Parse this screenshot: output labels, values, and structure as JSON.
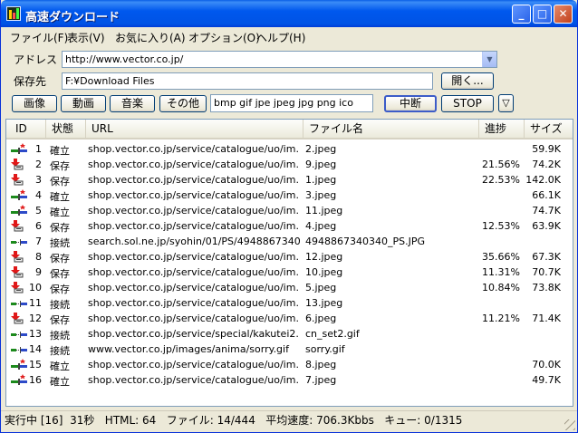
{
  "window": {
    "title": "高速ダウンロード",
    "minimize": "_",
    "maximize": "□",
    "close": "✕"
  },
  "menu": [
    "ファイル(F)",
    "表示(V)",
    "お気に入り(A)",
    "オプション(O)",
    "ヘルプ(H)"
  ],
  "address": {
    "label": "アドレス",
    "value": "http://www.vector.co.jp/"
  },
  "savedir": {
    "label": "保存先",
    "value": "F:¥Download Files",
    "open_button": "開く..."
  },
  "filters": {
    "buttons": [
      "画像",
      "動画",
      "音楽",
      "その他"
    ],
    "extensions": "bmp gif jpe jpeg jpg png ico",
    "pause_button": "中断",
    "stop_button": "STOP",
    "dropdown_glyph": "▽"
  },
  "list": {
    "columns": [
      "ID",
      "状態",
      "URL",
      "ファイル名",
      "進捗",
      "サイズ"
    ],
    "rows": [
      {
        "id": "1",
        "status": "確立",
        "icon": "connected-icon",
        "url": "shop.vector.co.jp/service/catalogue/uo/im...",
        "file": "2.jpeg",
        "progress": "",
        "size": "59.9K"
      },
      {
        "id": "2",
        "status": "保存",
        "icon": "saving-icon",
        "url": "shop.vector.co.jp/service/catalogue/uo/im...",
        "file": "9.jpeg",
        "progress": "21.56%",
        "size": "74.2K"
      },
      {
        "id": "3",
        "status": "保存",
        "icon": "saving-icon",
        "url": "shop.vector.co.jp/service/catalogue/uo/im...",
        "file": "1.jpeg",
        "progress": "22.53%",
        "size": "142.0K"
      },
      {
        "id": "4",
        "status": "確立",
        "icon": "connected-icon",
        "url": "shop.vector.co.jp/service/catalogue/uo/im...",
        "file": "3.jpeg",
        "progress": "",
        "size": "66.1K"
      },
      {
        "id": "5",
        "status": "確立",
        "icon": "connected-icon",
        "url": "shop.vector.co.jp/service/catalogue/uo/im...",
        "file": "11.jpeg",
        "progress": "",
        "size": "74.7K"
      },
      {
        "id": "6",
        "status": "保存",
        "icon": "saving-icon",
        "url": "shop.vector.co.jp/service/catalogue/uo/im...",
        "file": "4.jpeg",
        "progress": "12.53%",
        "size": "63.9K"
      },
      {
        "id": "7",
        "status": "接続",
        "icon": "connecting-icon",
        "url": "search.sol.ne.jp/syohin/01/PS/4948867340...",
        "file": "4948867340340_PS.JPG",
        "progress": "",
        "size": ""
      },
      {
        "id": "8",
        "status": "保存",
        "icon": "saving-icon",
        "url": "shop.vector.co.jp/service/catalogue/uo/im...",
        "file": "12.jpeg",
        "progress": "35.66%",
        "size": "67.3K"
      },
      {
        "id": "9",
        "status": "保存",
        "icon": "saving-icon",
        "url": "shop.vector.co.jp/service/catalogue/uo/im...",
        "file": "10.jpeg",
        "progress": "11.31%",
        "size": "70.7K"
      },
      {
        "id": "10",
        "status": "保存",
        "icon": "saving-icon",
        "url": "shop.vector.co.jp/service/catalogue/uo/im...",
        "file": "5.jpeg",
        "progress": "10.84%",
        "size": "73.8K"
      },
      {
        "id": "11",
        "status": "接続",
        "icon": "connecting-icon",
        "url": "shop.vector.co.jp/service/catalogue/uo/im...",
        "file": "13.jpeg",
        "progress": "",
        "size": ""
      },
      {
        "id": "12",
        "status": "保存",
        "icon": "saving-icon",
        "url": "shop.vector.co.jp/service/catalogue/uo/im...",
        "file": "6.jpeg",
        "progress": "11.21%",
        "size": "71.4K"
      },
      {
        "id": "13",
        "status": "接続",
        "icon": "connecting-icon",
        "url": "shop.vector.co.jp/service/special/kakutei2...",
        "file": "cn_set2.gif",
        "progress": "",
        "size": ""
      },
      {
        "id": "14",
        "status": "接続",
        "icon": "connecting-icon",
        "url": "www.vector.co.jp/images/anima/sorry.gif",
        "file": "sorry.gif",
        "progress": "",
        "size": ""
      },
      {
        "id": "15",
        "status": "確立",
        "icon": "connected-icon",
        "url": "shop.vector.co.jp/service/catalogue/uo/im...",
        "file": "8.jpeg",
        "progress": "",
        "size": "70.0K"
      },
      {
        "id": "16",
        "status": "確立",
        "icon": "connected-icon",
        "url": "shop.vector.co.jp/service/catalogue/uo/im...",
        "file": "7.jpeg",
        "progress": "",
        "size": "49.7K"
      }
    ]
  },
  "statusbar": {
    "text": "実行中 [16]  31秒   HTML: 64   ファイル: 14/444   平均速度: 706.3Kbbs   キュー: 0/1315"
  }
}
